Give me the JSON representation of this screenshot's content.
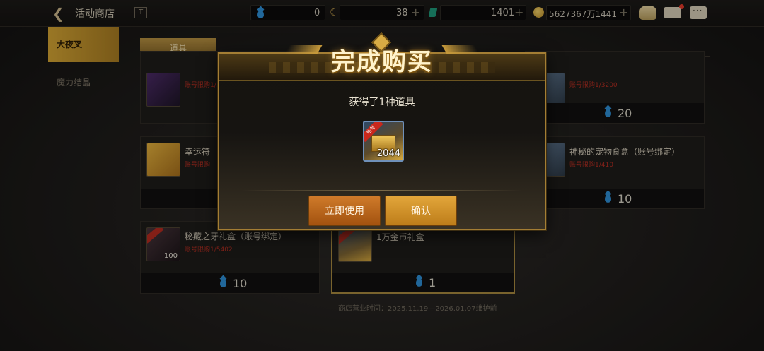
{
  "topbar": {
    "title": "活动商店",
    "info_icon": "T",
    "currencies": {
      "blue_drop": "0",
      "moon": "38",
      "gem": "1401",
      "gold": "5627367万1441"
    },
    "plus": "+"
  },
  "sidebar": {
    "items": [
      {
        "label": "大夜叉",
        "active": true
      },
      {
        "label": "魔力结晶",
        "active": false
      }
    ]
  },
  "tabs": [
    {
      "label": "道具"
    }
  ],
  "cards": [
    {
      "name": "",
      "limit": "账号限购1/100",
      "price": ""
    },
    {
      "name": "",
      "limit": "账号限购1/3200",
      "price": "20"
    },
    {
      "name": "幸运符",
      "limit": "账号限购",
      "price": ""
    },
    {
      "name": "神秘的宠物食盒（账号绑定）",
      "limit": "账号限购1/410",
      "price": "10"
    },
    {
      "name": "秘藏之牙礼盒（账号绑定）",
      "limit": "账号限购1/5402",
      "count": "100",
      "price": "10"
    },
    {
      "name": "1万金币礼盒",
      "limit": "",
      "price": "1"
    }
  ],
  "footer_note": "商店营业时间：2025.11.19—2026.01.07维护前",
  "dialog": {
    "title": "完成购买",
    "subtitle": "获得了1种道具",
    "reward": {
      "ribbon": "账号",
      "count": "2044"
    },
    "use_button": "立即使用",
    "confirm_button": "确认"
  }
}
